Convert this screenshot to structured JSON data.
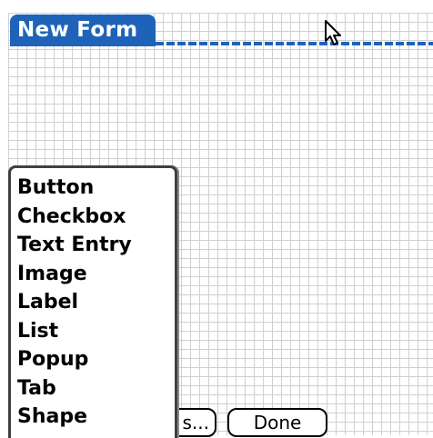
{
  "form": {
    "title": "New Form"
  },
  "buttons": {
    "hidden_label": "s...",
    "done_label": "Done"
  },
  "popup_menu": {
    "items": [
      {
        "label": "Button"
      },
      {
        "label": "Checkbox"
      },
      {
        "label": "Text Entry"
      },
      {
        "label": "Image"
      },
      {
        "label": "Label"
      },
      {
        "label": "List"
      },
      {
        "label": "Popup"
      },
      {
        "label": "Tab"
      },
      {
        "label": "Shape"
      }
    ]
  },
  "colors": {
    "title_bar": "#1f63b9",
    "grid_line": "#d0d0d0",
    "background": "#ffffff",
    "text": "#000000"
  },
  "icons": {
    "cursor": "arrow-cursor-icon"
  }
}
